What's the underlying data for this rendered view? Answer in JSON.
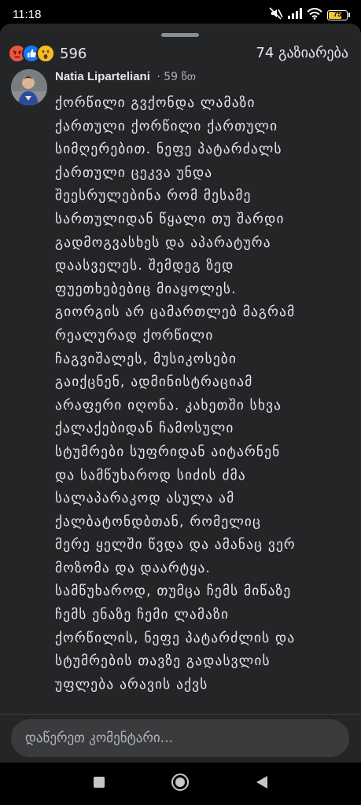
{
  "status_bar": {
    "time": "11:18",
    "battery_level": "75",
    "battery_fraction": 0.75,
    "icons": [
      "mute-icon",
      "signal-icon",
      "wifi-icon",
      "battery-icon"
    ]
  },
  "reactions": {
    "types": [
      "angry",
      "like",
      "wow"
    ],
    "colors": {
      "angry": "#f0533c",
      "like": "#1877f2",
      "wow": "#f7b928"
    },
    "count": "596"
  },
  "shares": "74 გაზიარება",
  "comment": {
    "author": "Natia Liparteliani",
    "time": "59 წთ",
    "lines": [
      "ქორწილი გვქონდა ლამაზი",
      "ქართული ქორწილი ქართული",
      "სიმღერებით. ნეფე პატარძალს",
      "ქართული ცეკვა უნდა",
      "შეესრულებინა რომ მესამე",
      "სართულიდან წყალი თუ შარდი",
      "გადმოგვასხეს და აპარატურა",
      "დაასველეს.  შემდეგ ზედ",
      "ფუეთხებებიც მიაყოლეს.",
      "გიორგის არ ცამართლებ მაგრამ",
      "რეალურად ქორწილი",
      "ჩაგვიშალეს, მუსიკოსები",
      "გაიქცნენ, ადმინისტრაციამ",
      "არაფერი იღონა. კახეთში სხვა",
      "ქალაქებიდან ჩამოსული",
      "სტუმრები სუფრიდან აიტარნენ",
      "და სამწუხაროდ სიძის ძმა",
      "სალაპარაკოდ ასულა ამ",
      "ქალბატონდბთან, რომელიც",
      "მერე ყელში წვდა და ამანაც ვერ",
      "მოზომა და დაარტყა.",
      "სამწუხაროდ, თუმცა ჩემს მიწაზე",
      "ჩემს ენაზე ჩემი ლამაზი",
      "ქორწილის, ნეფე პატარძლის და",
      "სტუმრების თავზე გადასვლის",
      "უფლება არავის აქვს"
    ]
  },
  "composer": {
    "placeholder": "დაწერეთ კომენტარი..."
  },
  "nav": {
    "buttons": [
      "recent-apps",
      "home",
      "back"
    ]
  }
}
